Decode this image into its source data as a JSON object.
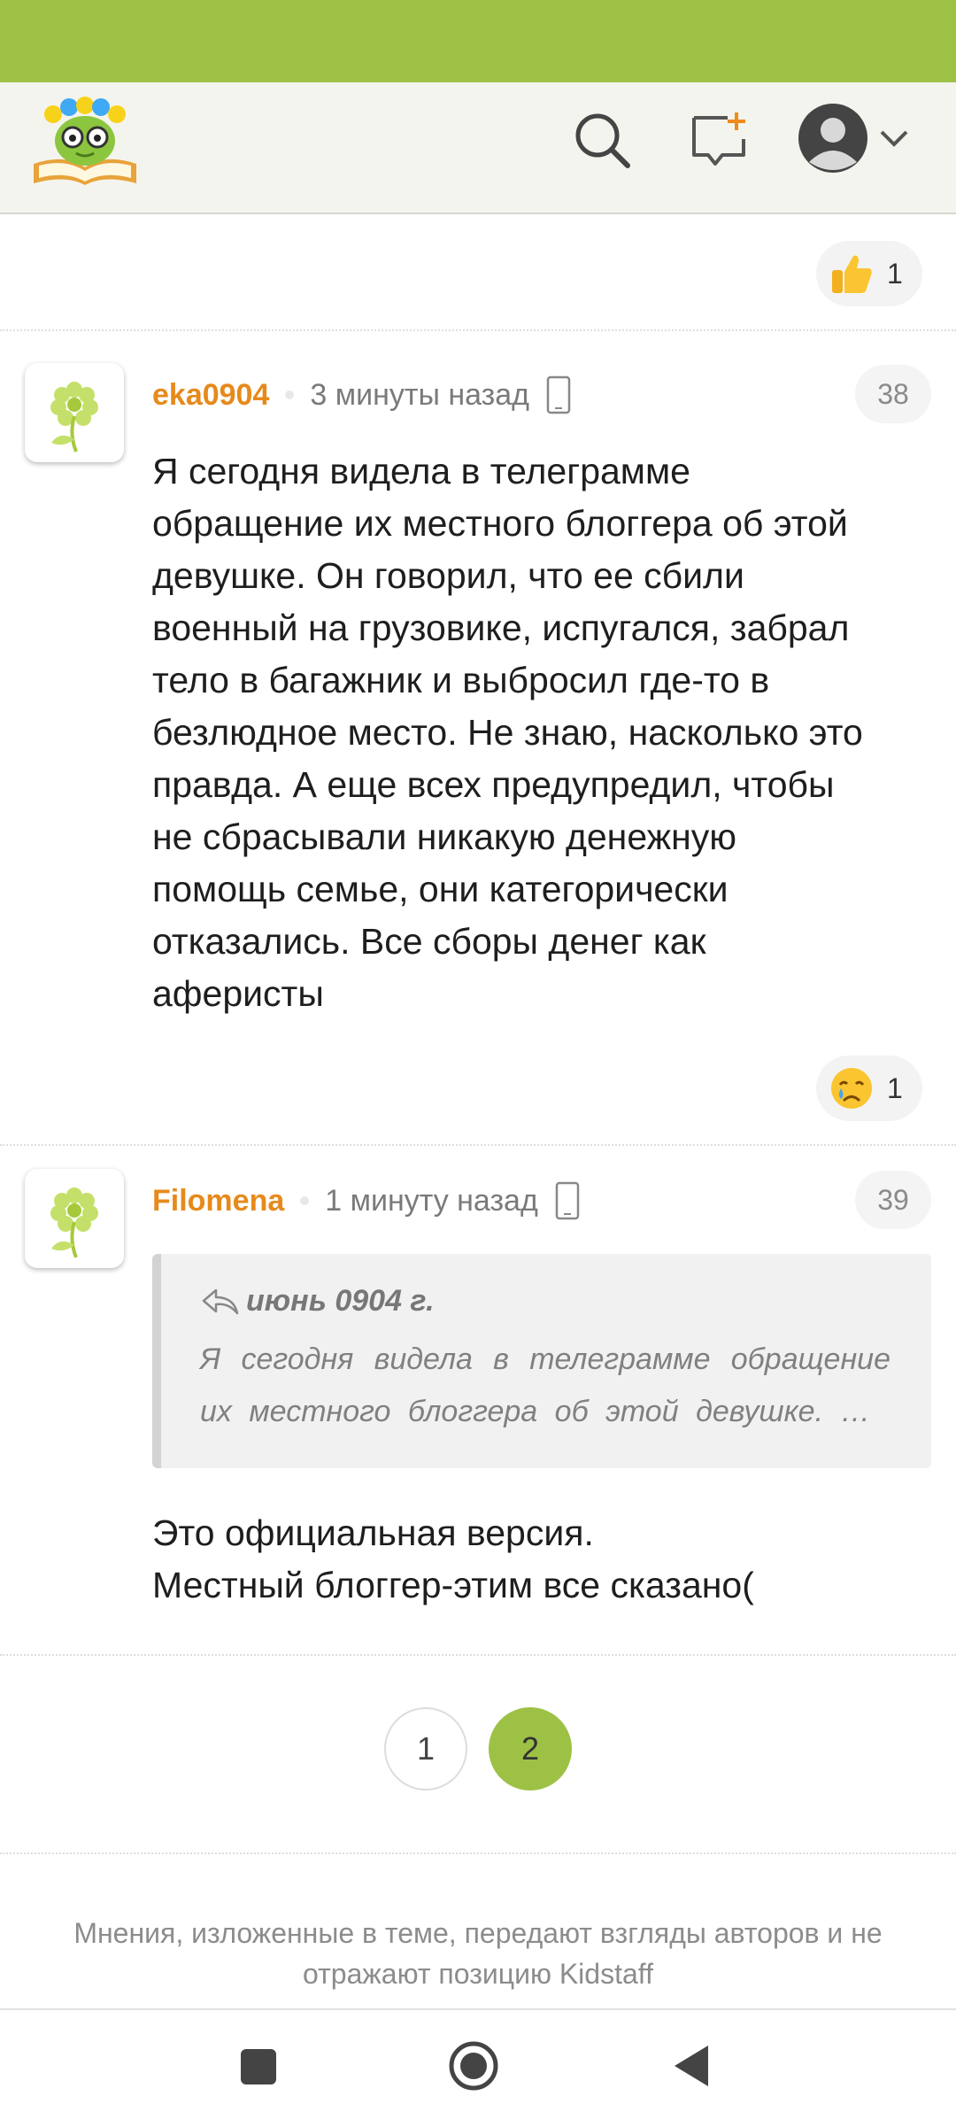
{
  "header": {
    "logo": "kidstaff-logo",
    "icons": [
      "search-icon",
      "new-topic-icon",
      "avatar-icon",
      "chevron-down-icon"
    ]
  },
  "prev_reaction": {
    "emoji": "thumbs-up-icon",
    "count": "1"
  },
  "comments": [
    {
      "author": "eka0904",
      "time": "3 минуты назад",
      "device": "phone-icon",
      "number": "38",
      "text": "Я сегодня видела в телеграмме\nобращение их местного блоггера об этой\nдевушке. Он говорил, что ее сбили\nвоенный на грузовике, испугался, забрал\nтело в багажник и выбросил где-то в\nбезлюдное место. Не знаю, насколько это\nправда. А еще всех предупредил, чтобы\nне сбрасывали никакую денежную\nпомощь семье, они категорически\nотказались. Все сборы денег как\nаферисты",
      "reaction": {
        "emoji": "crying-face-icon",
        "count": "1"
      }
    },
    {
      "author": "Filomena",
      "time": "1 минуту назад",
      "device": "phone-icon",
      "number": "39",
      "quote": {
        "author": "июнь 0904 г.",
        "text": "Я сегодня видела в телеграмме обращение их местного блоггера об этой девушке. …"
      },
      "text": "Это официальная версия.\nМестный блоггер-этим все сказано("
    }
  ],
  "pagination": {
    "pages": [
      "1",
      "2"
    ],
    "current": "2"
  },
  "disclaimer": "Мнения, изложенные в теме, передают взгляды авторов и не отражают позицию Kidstaff",
  "nav": [
    "recents-button",
    "home-button",
    "back-button"
  ],
  "colors": {
    "accent": "#9dc145",
    "author": "#e68a1b"
  }
}
